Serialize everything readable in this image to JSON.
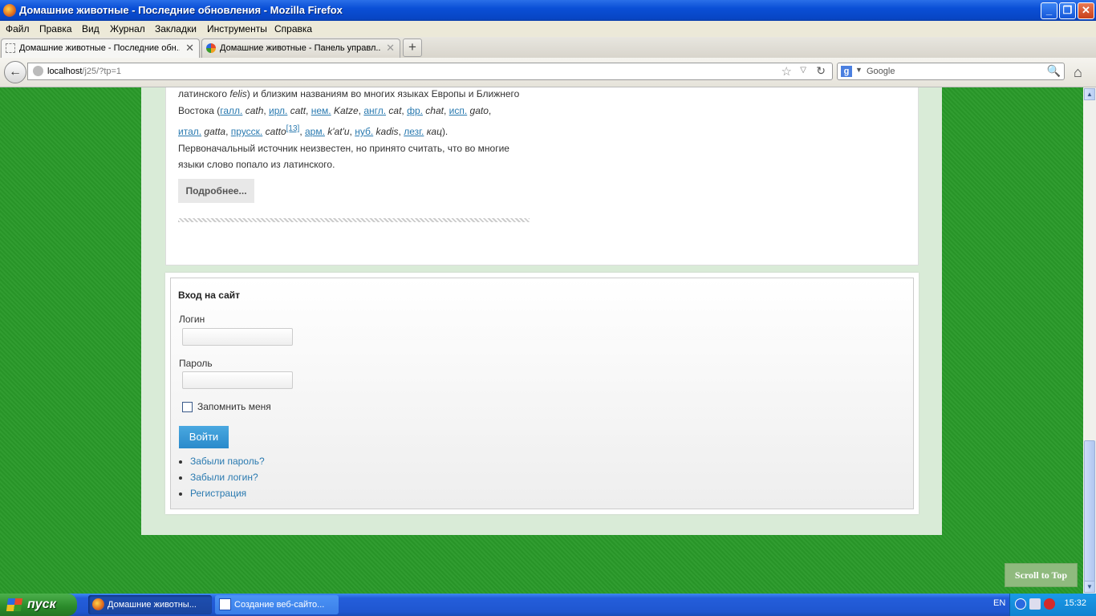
{
  "window": {
    "title": "Домашние животные - Последние обновления - Mozilla Firefox",
    "minimize": "_",
    "maximize": "❐",
    "close": "✕"
  },
  "menu": [
    "Файл",
    "Правка",
    "Вид",
    "Журнал",
    "Закладки",
    "Инструменты",
    "Справка"
  ],
  "tabs": [
    {
      "label": "Домашние животные - Последние обн...",
      "close": "✕"
    },
    {
      "label": "Домашние животные - Панель управл...",
      "close": "✕"
    }
  ],
  "new_tab": "+",
  "nav": {
    "back": "←",
    "url_host": "localhost",
    "url_path": "/j25/?tp=1",
    "star": "☆",
    "dropdown": "▽",
    "reload": "↻",
    "search_engine": "g",
    "search_dropdown": "▼",
    "search_placeholder": "Google",
    "search_icon": "🔍",
    "home": "⌂"
  },
  "article": {
    "line1_a": "латинского ",
    "line1_b": "felis",
    "line1_c": ") и близким названиям во многих языках Европы и Ближнего",
    "line2_a": "Востока (",
    "l_gall": "галл.",
    "w_gall": " cath",
    "l_irl": "ирл.",
    "w_irl": " catt",
    "l_nem": "нем.",
    "w_nem": " Katze",
    "l_angl": "англ.",
    "w_angl": " cat",
    "l_fr": "фр.",
    "w_fr": " chat",
    "l_isp": "исп.",
    "w_isp": " gato",
    "l_ital": "итал.",
    "w_ital": " gatta",
    "l_prussk": "прусск.",
    "w_prussk": " catto",
    "ref": "[13]",
    "l_arm": "арм.",
    "w_arm": " k'at'u",
    "l_nub": "нуб.",
    "w_nub": " kadis",
    "l_lezg": "лезг.",
    "w_lezg": " кац",
    "line3": "Первоначальный источник неизвестен, но принято считать, что во многие",
    "line4": "языки слово попало из латинского.",
    "read_more": "Подробнее..."
  },
  "login": {
    "heading": "Вход на сайт",
    "username_label": "Логин",
    "password_label": "Пароль",
    "remember_label": "Запомнить меня",
    "submit": "Войти",
    "links": [
      "Забыли пароль?",
      "Забыли логин?",
      "Регистрация"
    ]
  },
  "scroll_to_top": "Scroll to Top",
  "taskbar": {
    "start": "пуск",
    "items": [
      "Домашние животны...",
      "Создание веб-сайто..."
    ],
    "lang": "EN",
    "clock": "15:32"
  }
}
